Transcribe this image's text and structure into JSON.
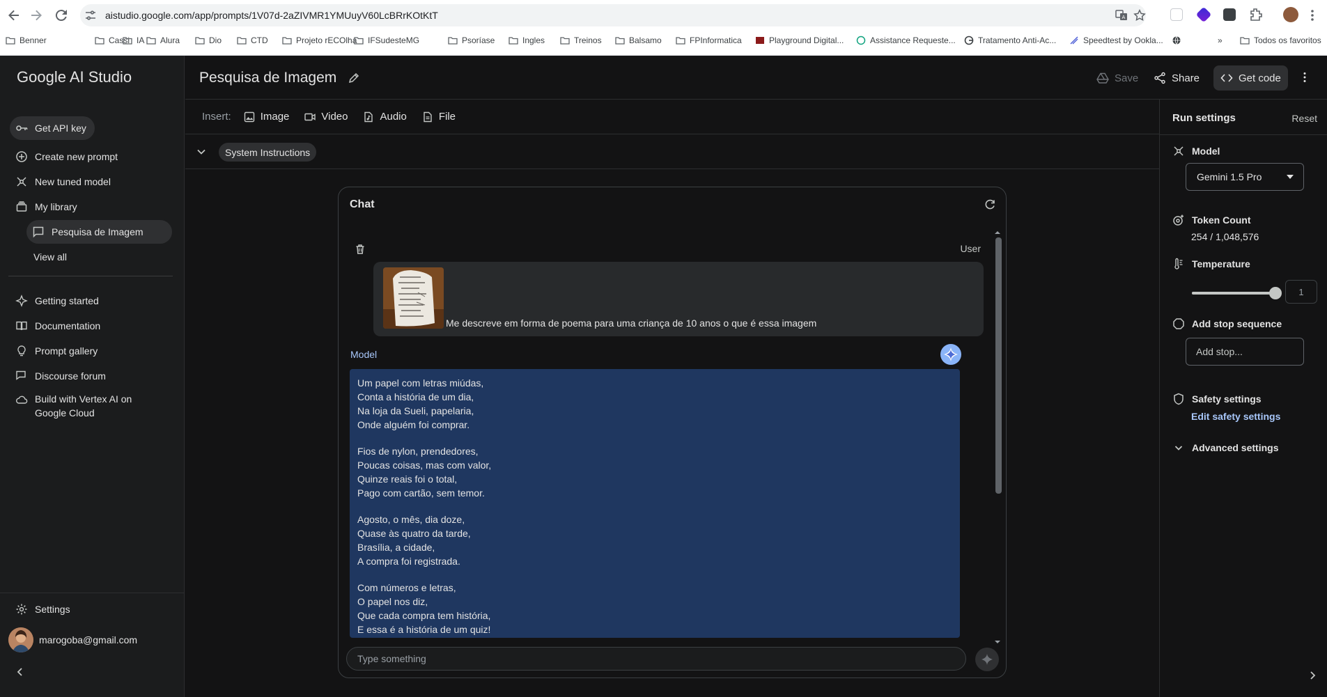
{
  "browser": {
    "url": "aistudio.google.com/app/prompts/1V07d-2aZIVMR1YMUuyV60LcBRrKOtKtT",
    "bookmarks": [
      "Benner",
      "Cassi",
      "IA",
      "Alura",
      "Dio",
      "CTD",
      "Projeto rECOlha",
      "IFSudesteMG",
      "Psoríase",
      "Ingles",
      "Treinos",
      "Balsamo",
      "FPInformatica",
      "Playground Digital...",
      "Assistance Requeste...",
      "Tratamento Anti-Ac...",
      "Speedtest by Ookla..."
    ],
    "more_label": "»",
    "all_bookmarks": "Todos os favoritos"
  },
  "sidebar": {
    "app_title": "Google AI Studio",
    "get_api_key": "Get API key",
    "create_new_prompt": "Create new prompt",
    "new_tuned_model": "New tuned model",
    "my_library": "My library",
    "active_prompt": "Pesquisa de Imagem",
    "view_all": "View all",
    "getting_started": "Getting started",
    "documentation": "Documentation",
    "prompt_gallery": "Prompt gallery",
    "discourse_forum": "Discourse forum",
    "build_vertex_line1": "Build with Vertex AI on",
    "build_vertex_line2": "Google Cloud",
    "settings": "Settings",
    "user_email": "marogoba@gmail.com"
  },
  "header": {
    "prompt_title": "Pesquisa de Imagem",
    "save": "Save",
    "share": "Share",
    "get_code": "Get code"
  },
  "insert": {
    "label": "Insert:",
    "image": "Image",
    "video": "Video",
    "audio": "Audio",
    "file": "File"
  },
  "system_instructions": "System Instructions",
  "chat": {
    "title": "Chat",
    "user_role": "User",
    "user_message": "Me descreve em forma de poema para uma criança de 10 anos o que é essa imagem",
    "model_role": "Model",
    "poem": [
      [
        "Um papel com letras miúdas,",
        "Conta a história de um dia,",
        "Na loja da Sueli, papelaria,",
        "Onde alguém foi comprar."
      ],
      [
        "Fios de nylon, prendedores,",
        "Poucas coisas, mas com valor,",
        "Quinze reais foi o total,",
        "Pago com cartão, sem temor."
      ],
      [
        "Agosto, o mês, dia doze,",
        "Quase às quatro da tarde,",
        "Brasília, a cidade,",
        "A compra foi registrada."
      ],
      [
        "Com números e letras,",
        "O papel nos diz,",
        "Que cada compra tem história,",
        "E essa é a história de um quiz!"
      ]
    ],
    "input_placeholder": "Type something"
  },
  "run_settings": {
    "title": "Run settings",
    "reset": "Reset",
    "model_label": "Model",
    "model_value": "Gemini 1.5 Pro",
    "token_label": "Token Count",
    "token_value": "254 / 1,048,576",
    "temperature_label": "Temperature",
    "temperature_value": "1",
    "temperature_fraction": 1.0,
    "stop_label": "Add stop sequence",
    "stop_placeholder": "Add stop...",
    "safety_label": "Safety settings",
    "edit_safety": "Edit safety settings",
    "advanced": "Advanced settings"
  },
  "colors": {
    "accent_link": "#a8c7fa",
    "model_bubble": "#1f3760",
    "background": "#131314"
  }
}
